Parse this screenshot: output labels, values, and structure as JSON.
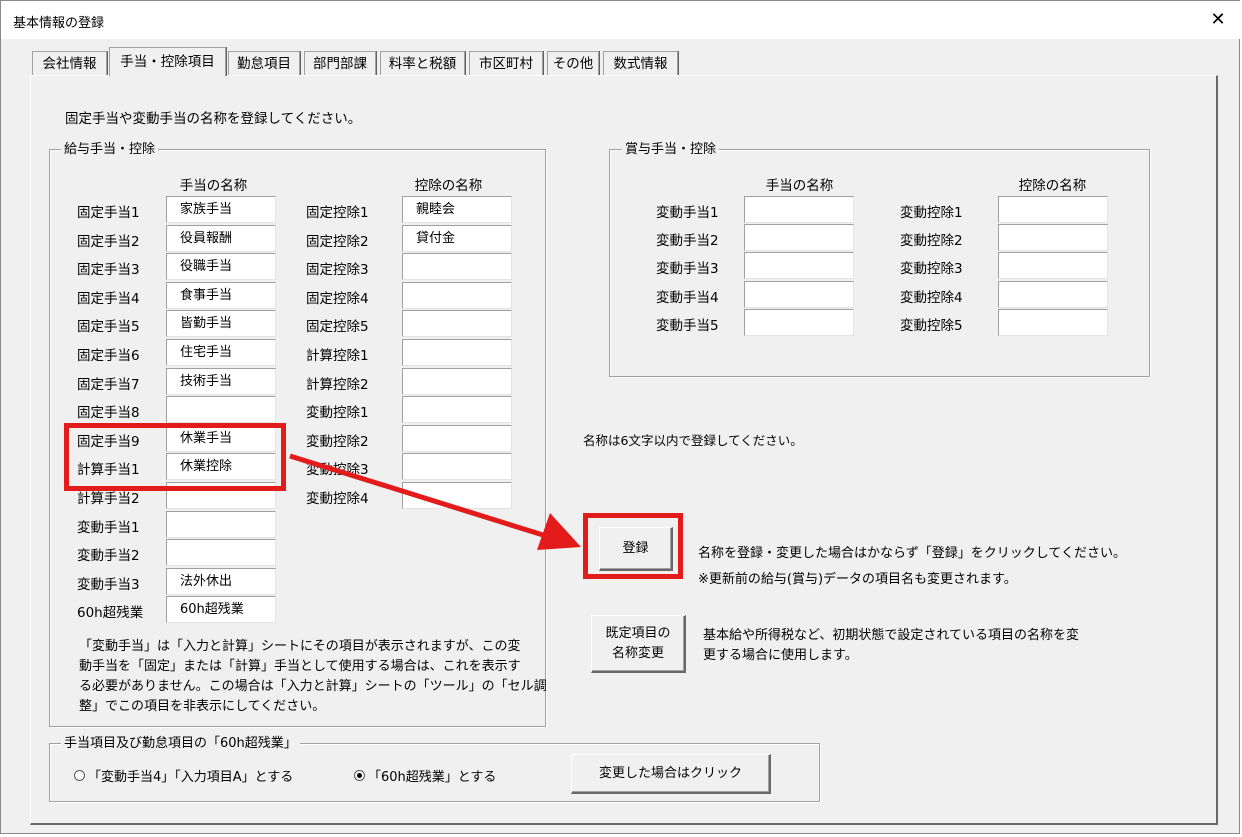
{
  "window": {
    "title": "基本情報の登録",
    "close_glyph": "✕"
  },
  "tabs": [
    {
      "label": "会社情報",
      "active": false
    },
    {
      "label": "手当・控除項目",
      "active": true
    },
    {
      "label": "勤怠項目",
      "active": false
    },
    {
      "label": "部門部課",
      "active": false
    },
    {
      "label": "料率と税額",
      "active": false
    },
    {
      "label": "市区町村",
      "active": false
    },
    {
      "label": "その他",
      "active": false
    },
    {
      "label": "数式情報",
      "active": false
    }
  ],
  "instruction": "固定手当や変動手当の名称を登録してください。",
  "salary_frame": {
    "caption": "給与手当・控除",
    "allowance_header": "手当の名称",
    "deduction_header": "控除の名称",
    "allowances": [
      {
        "label": "固定手当1",
        "value": "家族手当"
      },
      {
        "label": "固定手当2",
        "value": "役員報酬"
      },
      {
        "label": "固定手当3",
        "value": "役職手当"
      },
      {
        "label": "固定手当4",
        "value": "食事手当"
      },
      {
        "label": "固定手当5",
        "value": "皆勤手当"
      },
      {
        "label": "固定手当6",
        "value": "住宅手当"
      },
      {
        "label": "固定手当7",
        "value": "技術手当"
      },
      {
        "label": "固定手当8",
        "value": ""
      },
      {
        "label": "固定手当9",
        "value": "休業手当"
      },
      {
        "label": "計算手当1",
        "value": "休業控除"
      },
      {
        "label": "計算手当2",
        "value": ""
      },
      {
        "label": "変動手当1",
        "value": ""
      },
      {
        "label": "変動手当2",
        "value": ""
      },
      {
        "label": "変動手当3",
        "value": "法外休出"
      },
      {
        "label": "60h超残業",
        "value": "60h超残業"
      }
    ],
    "deductions": [
      {
        "label": "固定控除1",
        "value": "親睦会"
      },
      {
        "label": "固定控除2",
        "value": "貸付金"
      },
      {
        "label": "固定控除3",
        "value": ""
      },
      {
        "label": "固定控除4",
        "value": ""
      },
      {
        "label": "固定控除5",
        "value": ""
      },
      {
        "label": "計算控除1",
        "value": ""
      },
      {
        "label": "計算控除2",
        "value": ""
      },
      {
        "label": "変動控除1",
        "value": ""
      },
      {
        "label": "変動控除2",
        "value": ""
      },
      {
        "label": "変動控除3",
        "value": ""
      },
      {
        "label": "変動控除4",
        "value": ""
      }
    ],
    "note_lines": [
      "「変動手当」は「入力と計算」シートにその項目が表示されますが、この変",
      "動手当を「固定」または「計算」手当として使用する場合は、これを表示す",
      "る必要がありません。この場合は「入力と計算」シートの「ツール」の「セル調",
      "整」でこの項目を非表示にしてください。"
    ]
  },
  "bonus_frame": {
    "caption": "賞与手当・控除",
    "allowance_header": "手当の名称",
    "deduction_header": "控除の名称",
    "allowances": [
      {
        "label": "変動手当1",
        "value": ""
      },
      {
        "label": "変動手当2",
        "value": ""
      },
      {
        "label": "変動手当3",
        "value": ""
      },
      {
        "label": "変動手当4",
        "value": ""
      },
      {
        "label": "変動手当5",
        "value": ""
      }
    ],
    "deductions": [
      {
        "label": "変動控除1",
        "value": ""
      },
      {
        "label": "変動控除2",
        "value": ""
      },
      {
        "label": "変動控除3",
        "value": ""
      },
      {
        "label": "変動控除4",
        "value": ""
      },
      {
        "label": "変動控除5",
        "value": ""
      }
    ]
  },
  "name_limit_note": "名称は6文字以内で登録してください。",
  "register": {
    "button_label": "登録",
    "note_line1": "名称を登録・変更した場合はかならず「登録」をクリックしてください。",
    "note_line2": "※更新前の給与(賞与)データの項目名も変更されます。"
  },
  "default_names": {
    "button_line1": "既定項目の",
    "button_line2": "名称変更",
    "note_line1": "基本給や所得税など、初期状態で設定されている項目の名称を変",
    "note_line2": "更する場合に使用します。"
  },
  "overtime_frame": {
    "caption": "手当項目及び勤怠項目の「60h超残業」",
    "option1": "「変動手当4」「入力項目A」とする",
    "option2": "「60h超残業」とする",
    "selected": 2,
    "apply_button": "変更した場合はクリック"
  },
  "annotation": {
    "color": "#e31b1b"
  }
}
